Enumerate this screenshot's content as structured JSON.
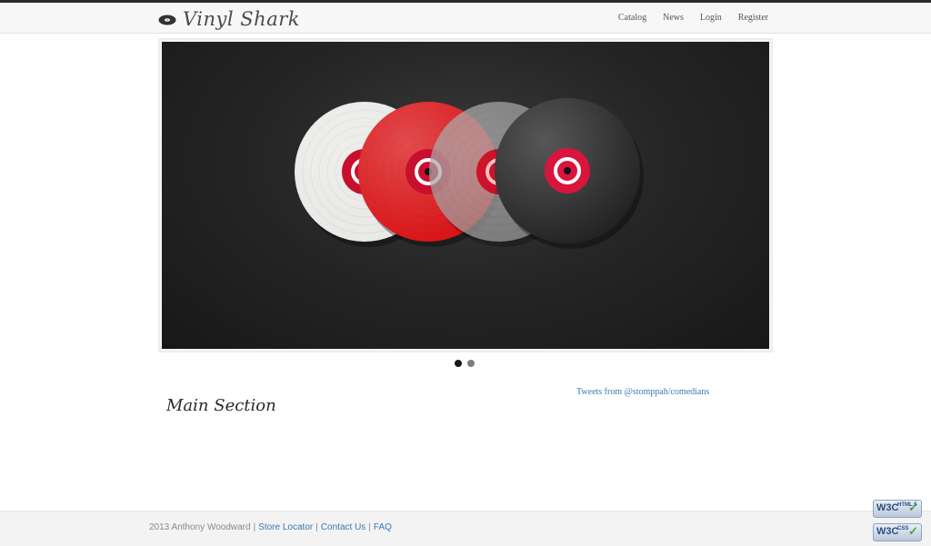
{
  "header": {
    "logo_text": "Vinyl Shark",
    "nav": [
      {
        "label": "Catalog"
      },
      {
        "label": "News"
      },
      {
        "label": "Login"
      },
      {
        "label": "Register"
      }
    ]
  },
  "slider": {
    "records": [
      {
        "color": "#e8e8e6",
        "label_color": "#c8102e"
      },
      {
        "color": "#d80f12",
        "label_color": "#c8102e"
      },
      {
        "color": "#9a9a9a",
        "label_color": "#c8102e"
      },
      {
        "color": "#1f1f1f",
        "label_color": "#d9143d"
      }
    ],
    "slide_count": 2,
    "active_index": 0
  },
  "main": {
    "heading": "Main Section",
    "tweets_link": "Tweets from @stomppah/comedians"
  },
  "footer": {
    "copyright": "2013 Anthony Woodward",
    "separator": "|",
    "links": [
      {
        "label": "Store Locator"
      },
      {
        "label": "Contact Us"
      },
      {
        "label": "FAQ"
      }
    ]
  },
  "badges": [
    {
      "w3": "W3C",
      "kind": "HTML 5"
    },
    {
      "w3": "W3C",
      "kind": "CSS"
    }
  ],
  "colors": {
    "link": "#3b78b5",
    "topbar": "#2b2b2b"
  }
}
